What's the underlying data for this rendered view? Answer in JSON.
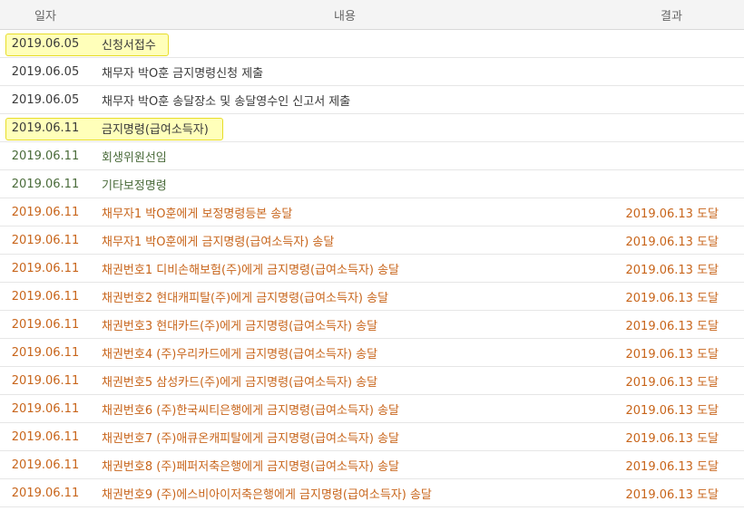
{
  "header": {
    "col_date": "일자",
    "col_content": "내용",
    "col_result": "결과"
  },
  "rows": [
    {
      "date": "2019.06.05",
      "content": "신청서접수",
      "result": ""
    },
    {
      "date": "2019.06.05",
      "content": "채무자 박O훈 금지명령신청 제출",
      "result": ""
    },
    {
      "date": "2019.06.05",
      "content": "채무자 박O훈 송달장소 및 송달영수인 신고서 제출",
      "result": ""
    },
    {
      "date": "2019.06.11",
      "content": "금지명령(급여소득자)",
      "result": ""
    },
    {
      "date": "2019.06.11",
      "content": "회생위원선임",
      "result": ""
    },
    {
      "date": "2019.06.11",
      "content": "기타보정명령",
      "result": ""
    },
    {
      "date": "2019.06.11",
      "content": "채무자1 박O훈에게 보정명령등본 송달",
      "result": "2019.06.13 도달"
    },
    {
      "date": "2019.06.11",
      "content": "채무자1 박O훈에게 금지명령(급여소득자) 송달",
      "result": "2019.06.13 도달"
    },
    {
      "date": "2019.06.11",
      "content": "채권번호1 디비손해보험(주)에게 금지명령(급여소득자) 송달",
      "result": "2019.06.13 도달"
    },
    {
      "date": "2019.06.11",
      "content": "채권번호2 현대캐피탈(주)에게 금지명령(급여소득자) 송달",
      "result": "2019.06.13 도달"
    },
    {
      "date": "2019.06.11",
      "content": "채권번호3 현대카드(주)에게 금지명령(급여소득자) 송달",
      "result": "2019.06.13 도달"
    },
    {
      "date": "2019.06.11",
      "content": "채권번호4 (주)우리카드에게 금지명령(급여소득자) 송달",
      "result": "2019.06.13 도달"
    },
    {
      "date": "2019.06.11",
      "content": "채권번호5 삼성카드(주)에게 금지명령(급여소득자) 송달",
      "result": "2019.06.13 도달"
    },
    {
      "date": "2019.06.11",
      "content": "채권번호6 (주)한국씨티은행에게 금지명령(급여소득자) 송달",
      "result": "2019.06.13 도달"
    },
    {
      "date": "2019.06.11",
      "content": "채권번호7 (주)애큐온캐피탈에게 금지명령(급여소득자) 송달",
      "result": "2019.06.13 도달"
    },
    {
      "date": "2019.06.11",
      "content": "채권번호8 (주)페퍼저축은행에게 금지명령(급여소득자) 송달",
      "result": "2019.06.13 도달"
    },
    {
      "date": "2019.06.11",
      "content": "채권번호9 (주)에스비아이저축은행에게 금지명령(급여소득자) 송달",
      "result": "2019.06.13 도달"
    }
  ],
  "colors": {
    "dark_text": "#3a3a3a",
    "green_text": "#4a6b3a",
    "orange_text": "#c8651b",
    "highlight": "#ffff82"
  }
}
